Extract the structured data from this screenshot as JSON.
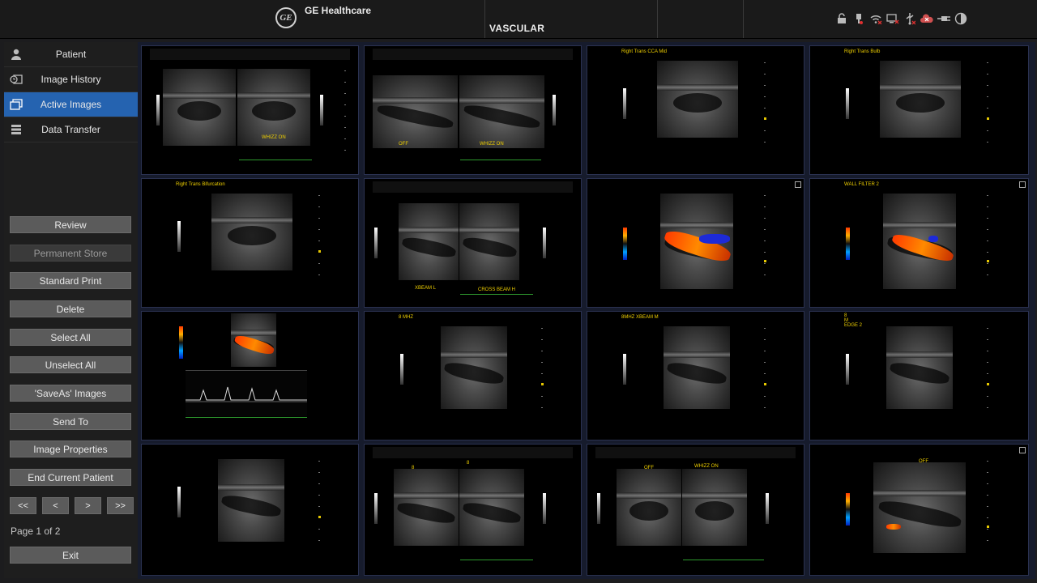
{
  "header": {
    "brand": "GE Healthcare",
    "logo_text": "GE",
    "mode": "VASCULAR",
    "status_icons": [
      "lock-icon",
      "network-plug-icon",
      "wifi-icon",
      "display-icon",
      "usb-icon",
      "cloud-icon",
      "cable-icon",
      "contrast-icon"
    ]
  },
  "sidebar": {
    "nav": [
      {
        "label": "Patient",
        "icon": "person-icon"
      },
      {
        "label": "Image History",
        "icon": "history-icon"
      },
      {
        "label": "Active Images",
        "icon": "images-icon",
        "active": true
      },
      {
        "label": "Data Transfer",
        "icon": "data-transfer-icon"
      }
    ],
    "buttons": [
      {
        "label": "Review"
      },
      {
        "label": "Permanent Store",
        "disabled": true
      },
      {
        "label": "Standard Print"
      },
      {
        "label": "Delete"
      },
      {
        "label": "Select All"
      },
      {
        "label": "Unselect All"
      },
      {
        "label": "'SaveAs' Images"
      },
      {
        "label": "Send To"
      },
      {
        "label": "Image Properties"
      },
      {
        "label": "End Current Patient"
      }
    ],
    "pager": [
      "<<",
      "<",
      ">",
      ">>"
    ],
    "page_info": "Page 1 of 2",
    "exit_label": "Exit"
  },
  "images": [
    {
      "labels": [
        "WHIZZ ON"
      ]
    },
    {
      "labels": [
        "OFF",
        "WHIZZ ON"
      ]
    },
    {
      "labels": [
        "Right Trans CCA Mid"
      ]
    },
    {
      "labels": [
        "Right Trans Bulb"
      ]
    },
    {
      "labels": [
        "Right Trans Bifurcation"
      ]
    },
    {
      "labels": [
        "XBEAM L",
        "CROSS BEAM H"
      ]
    },
    {
      "labels": []
    },
    {
      "labels": [
        "WALL FILTER 2"
      ]
    },
    {
      "labels": []
    },
    {
      "labels": [
        "8 MHZ"
      ]
    },
    {
      "labels": [
        "8MHZ XBEAM M"
      ]
    },
    {
      "labels": [
        "8",
        "M",
        "EDGE 2"
      ]
    },
    {
      "labels": []
    },
    {
      "labels": [
        "8",
        "8"
      ]
    },
    {
      "labels": [
        "OFF",
        "WHIZZ ON"
      ]
    },
    {
      "labels": [
        "OFF"
      ]
    }
  ],
  "colors": {
    "accent": "#2563b0",
    "label": "#f0d000",
    "grid_bg": "#161b2c"
  }
}
